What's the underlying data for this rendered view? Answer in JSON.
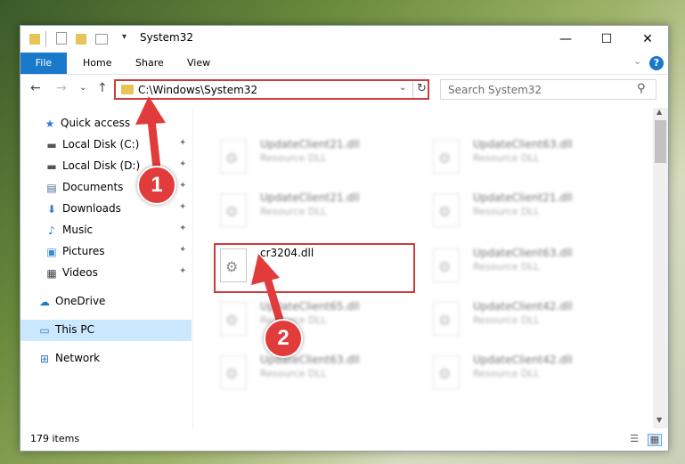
{
  "window": {
    "title": "System32",
    "minimize": "—",
    "maximize": "☐",
    "close": "✕"
  },
  "ribbon": {
    "tabs": [
      "File",
      "Home",
      "Share",
      "View"
    ],
    "help": "?",
    "expand": "⌄"
  },
  "nav": {
    "back": "←",
    "forward": "→",
    "recent": "⌄",
    "up": "↑",
    "address": "C:\\Windows\\System32",
    "address_dropdown": "⌄",
    "refresh": "↻",
    "search_placeholder": "Search System32"
  },
  "sidebar": {
    "items": [
      {
        "label": "Quick access",
        "icon": "star-icon",
        "glyph": "★",
        "color": "#2e7bd6",
        "pinned": false
      },
      {
        "label": "Local Disk (C:)",
        "icon": "drive-icon",
        "glyph": "▬",
        "color": "#555555",
        "pinned": true
      },
      {
        "label": "Local Disk (D:)",
        "icon": "drive-icon",
        "glyph": "▬",
        "color": "#555555",
        "pinned": true
      },
      {
        "label": "Documents",
        "icon": "document-icon",
        "glyph": "▤",
        "color": "#4a6c92",
        "pinned": true
      },
      {
        "label": "Downloads",
        "icon": "download-icon",
        "glyph": "⬇",
        "color": "#2e7bd6",
        "pinned": true
      },
      {
        "label": "Music",
        "icon": "music-icon",
        "glyph": "♪",
        "color": "#2e7bd6",
        "pinned": true
      },
      {
        "label": "Pictures",
        "icon": "pictures-icon",
        "glyph": "▣",
        "color": "#3b8ad6",
        "pinned": true
      },
      {
        "label": "Videos",
        "icon": "video-icon",
        "glyph": "▦",
        "color": "#444444",
        "pinned": true
      },
      {
        "label": "OneDrive",
        "icon": "cloud-icon",
        "glyph": "☁",
        "color": "#1979ca",
        "pinned": false
      },
      {
        "label": "This PC",
        "icon": "computer-icon",
        "glyph": "▭",
        "color": "#2e7bd6",
        "pinned": false
      },
      {
        "label": "Network",
        "icon": "network-icon",
        "glyph": "⊞",
        "color": "#2e7bd6",
        "pinned": false
      }
    ],
    "pin_glyph": "📌"
  },
  "files": {
    "left": [
      {
        "name": "UpdateClient21.dll",
        "type": "Resource DLL",
        "blurred": true
      },
      {
        "name": "UpdateClient21.dll",
        "type": "Resource DLL",
        "blurred": true
      },
      {
        "name": "cr3204.dll",
        "type": "",
        "blurred": false
      },
      {
        "name": "UpdateClient65.dll",
        "type": "Resource DLL",
        "blurred": true
      },
      {
        "name": "UpdateClient63.dll",
        "type": "Resource DLL",
        "blurred": true
      }
    ],
    "right": [
      {
        "name": "UpdateClient63.dll",
        "type": "Resource DLL",
        "blurred": true
      },
      {
        "name": "UpdateClient21.dll",
        "type": "Resource DLL",
        "blurred": true
      },
      {
        "name": "UpdateClient63.dll",
        "type": "Resource DLL",
        "blurred": true
      },
      {
        "name": "UpdateClient42.dll",
        "type": "Resource DLL",
        "blurred": true
      },
      {
        "name": "UpdateClient42.dll",
        "type": "Resource DLL",
        "blurred": true
      }
    ]
  },
  "status": {
    "items_count": "179 items"
  },
  "annotations": {
    "step1": "1",
    "step2": "2",
    "color": "#e23b3b"
  }
}
